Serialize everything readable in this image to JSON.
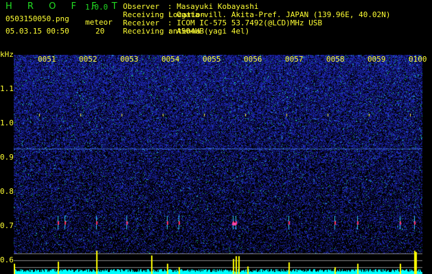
{
  "app": {
    "name": "H R O F F T",
    "version": "1.0.0"
  },
  "file": {
    "name": "0503150050.png",
    "datetime": "05.03.15 00:50",
    "meteor_label": "meteor",
    "meteor_count": "20"
  },
  "info": [
    {
      "label": "Observer",
      "value": ": Masayuki Kobayashi"
    },
    {
      "label": "Receiving Location",
      "value": ": Ogata-vill. Akita-Pref. JAPAN (139.96E, 40.02N)"
    },
    {
      "label": "Receiver",
      "value": ": ICOM IC-575 53.7492(@LCD)MHz USB"
    },
    {
      "label": "Receiving antenna",
      "value": ": A504HB(yagi 4el)"
    }
  ],
  "axis": {
    "unit": "kHz",
    "y_ticks": [
      "1.1",
      "1.0",
      "0.9",
      "0.8",
      "0.7",
      "0.6"
    ],
    "time_ticks": [
      "0051",
      "0052",
      "0053",
      "0054",
      "0055",
      "0056",
      "0057",
      "0058",
      "0059",
      "0100"
    ]
  },
  "colors": {
    "text": "#ffff33",
    "logo": "#22dd22",
    "background_noise": "#1a1aa0",
    "meter": "#00ffff",
    "meteor": "#ffff00"
  }
}
